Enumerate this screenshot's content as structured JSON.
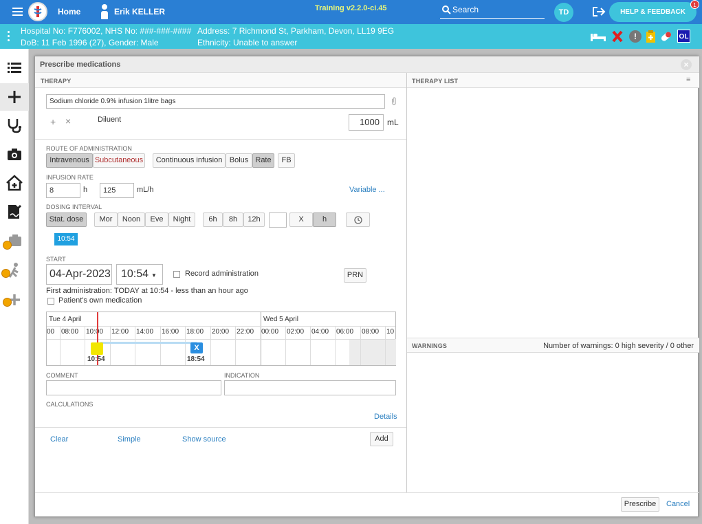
{
  "topbar": {
    "home_label": "Home",
    "user_name": "Erik KELLER",
    "training_label": "Training v2.2.0-ci.45",
    "search_label": "Search",
    "user_initials": "TD",
    "help_label": "HELP & FEEDBACK",
    "help_badge": "1"
  },
  "patient": {
    "line1": "Hospital No: F776002, NHS No: ###-###-####",
    "line2": "DoB: 11 Feb 1996 (27), Gender: Male",
    "address": "Address: 7 Richmond St, Parkham, Devon, LL19 9EG",
    "ethnicity": "Ethnicity: Unable to answer",
    "ol_badge": "OL"
  },
  "dialog": {
    "title": "Prescribe medications",
    "therapy_header": "THERAPY",
    "therapy_list_header": "THERAPY LIST",
    "warnings_header": "WARNINGS",
    "warnings_summary": "Number of warnings: 0 high severity / 0 other"
  },
  "therapy": {
    "medication": "Sodium chloride 0.9% infusion 1litre bags",
    "diluent_label": "Diluent",
    "volume": "1000",
    "volume_unit": "mL"
  },
  "route": {
    "label": "ROUTE OF ADMINISTRATION",
    "options": [
      "Intravenous",
      "Subcutaneous"
    ],
    "selected": "Intravenous",
    "modes": [
      "Continuous infusion",
      "Bolus",
      "Rate"
    ],
    "selected_mode": "Rate",
    "fb": "FB"
  },
  "rate": {
    "label": "INFUSION RATE",
    "hours": "8",
    "hours_unit": "h",
    "value": "125",
    "unit": "mL/h",
    "variable_link": "Variable ..."
  },
  "dosing": {
    "label": "DOSING INTERVAL",
    "stat": "Stat. dose",
    "times": [
      "Mor",
      "Noon",
      "Eve",
      "Night"
    ],
    "intervals": [
      "6h",
      "8h",
      "12h"
    ],
    "x_label": "X",
    "h_label": "h",
    "stat_time": "10:54"
  },
  "start": {
    "label": "START",
    "date": "04-Apr-2023",
    "time": "10:54",
    "record_admin": "Record administration",
    "prn": "PRN",
    "first_admin": "First administration: TODAY at 10:54 - less than an hour ago",
    "own_med": "Patient's own medication"
  },
  "timeline": {
    "day1": "Tue 4 April",
    "day2": "Wed 5 April",
    "hours": [
      "00",
      "08:00",
      "10:00",
      "12:00",
      "14:00",
      "16:00",
      "18:00",
      "20:00",
      "22:00",
      "00:00",
      "02:00",
      "04:00",
      "06:00",
      "08:00",
      "10"
    ],
    "start_marker": "10:54",
    "end_marker": "18:54",
    "end_icon": "X"
  },
  "fields": {
    "comment_label": "COMMENT",
    "indication_label": "INDICATION",
    "calculations_label": "CALCULATIONS",
    "details_link": "Details"
  },
  "footer": {
    "clear": "Clear",
    "simple": "Simple",
    "show_source": "Show source",
    "add": "Add",
    "prescribe": "Prescribe",
    "cancel": "Cancel"
  },
  "colors": {
    "topbar": "#2a7fd4",
    "patientbar": "#3ec4dc",
    "link": "#2a7fc0",
    "subcut": "#b03030",
    "marker": "#f2e600",
    "end": "#2a8ee0"
  }
}
